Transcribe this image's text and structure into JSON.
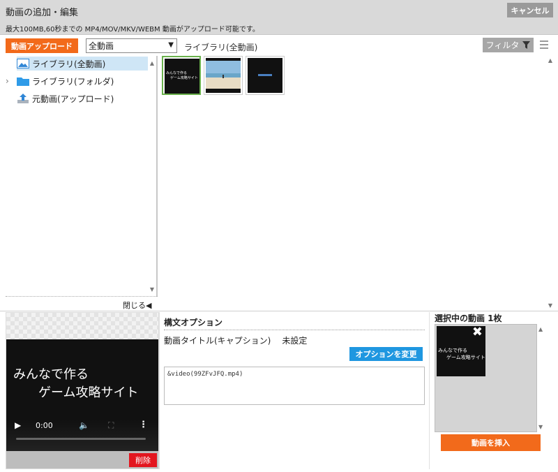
{
  "header": {
    "title": "動画の追加・編集",
    "subtitle": "最大100MB,60秒までの MP4/MOV/MKV/WEBM 動画がアップロード可能です。",
    "cancel_label": "キャンセル"
  },
  "toolbar": {
    "upload_label": "動画アップロード",
    "select_value": "全動画",
    "library_label": "ライブラリ(全動画)",
    "filter_label": "フィルタ"
  },
  "tree": {
    "items": [
      {
        "label": "ライブラリ(全動画)",
        "icon": "image-icon"
      },
      {
        "label": "ライブラリ(フォルダ)",
        "icon": "folder-icon"
      },
      {
        "label": "元動画(アップロード)",
        "icon": "upload-icon"
      }
    ],
    "close_label": "閉じる◀"
  },
  "thumbnails": [
    {
      "caption": "みんなで作るゲーム攻略サイト",
      "selected": true
    },
    {
      "caption": "",
      "selected": false
    },
    {
      "caption": "",
      "selected": false
    }
  ],
  "preview": {
    "line1": "みんなで作る",
    "line2": "ゲーム攻略サイト",
    "time": "0:00",
    "delete_label": "削除"
  },
  "options": {
    "title": "構文オプション",
    "caption_label": "動画タイトル(キャプション)",
    "caption_value": "未設定",
    "change_label": "オプションを変更",
    "syntax": "&video(99ZFvJFQ.mp4)"
  },
  "selected": {
    "title": "選択中の動画 1枚",
    "thumb_line1": "みんなで作る",
    "thumb_line2": "ゲーム攻略サイト",
    "insert_label": "動画を挿入"
  },
  "colors": {
    "accent_orange": "#f26a1b",
    "accent_blue": "#1f97e0",
    "delete_red": "#e3161f"
  }
}
